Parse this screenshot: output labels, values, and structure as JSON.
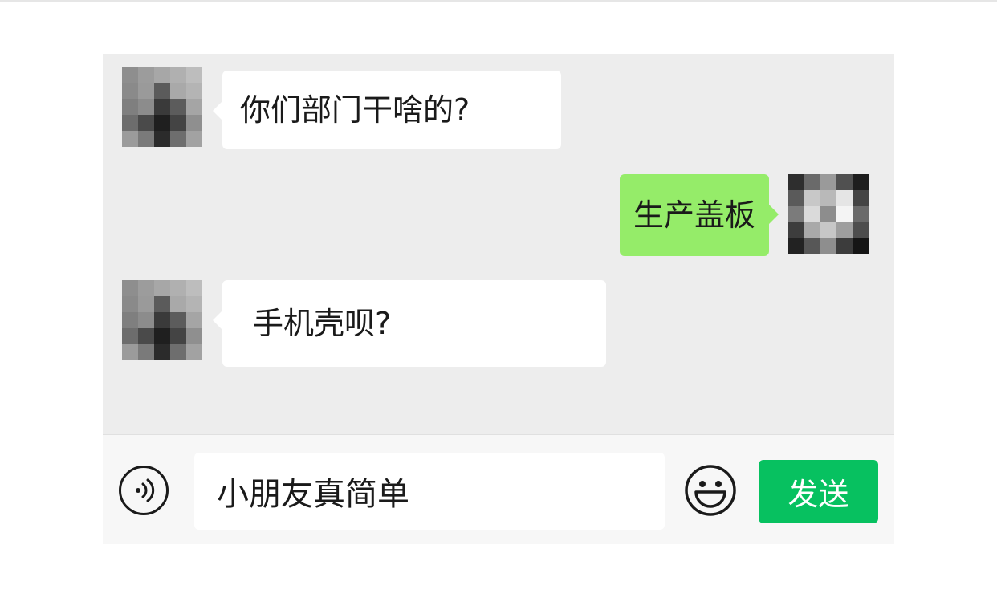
{
  "conversation": {
    "messages": [
      {
        "direction": "incoming",
        "text": "你们部门干啥的?",
        "sender_avatar": "blurred-avatar-icon"
      },
      {
        "direction": "outgoing",
        "text": "生产盖板",
        "sender_avatar": "blurred-avatar-icon"
      },
      {
        "direction": "incoming",
        "text": "手机壳呗?",
        "sender_avatar": "blurred-avatar-icon"
      }
    ]
  },
  "input_bar": {
    "voice_icon": "voice-icon",
    "input_value": "小朋友真简单",
    "emoji_icon": "smiley-icon",
    "send_label": "发送"
  },
  "colors": {
    "chat_background": "#ededed",
    "incoming_bubble": "#ffffff",
    "outgoing_bubble": "#95ec69",
    "send_button": "#07c160",
    "input_bar_background": "#f7f7f7"
  }
}
